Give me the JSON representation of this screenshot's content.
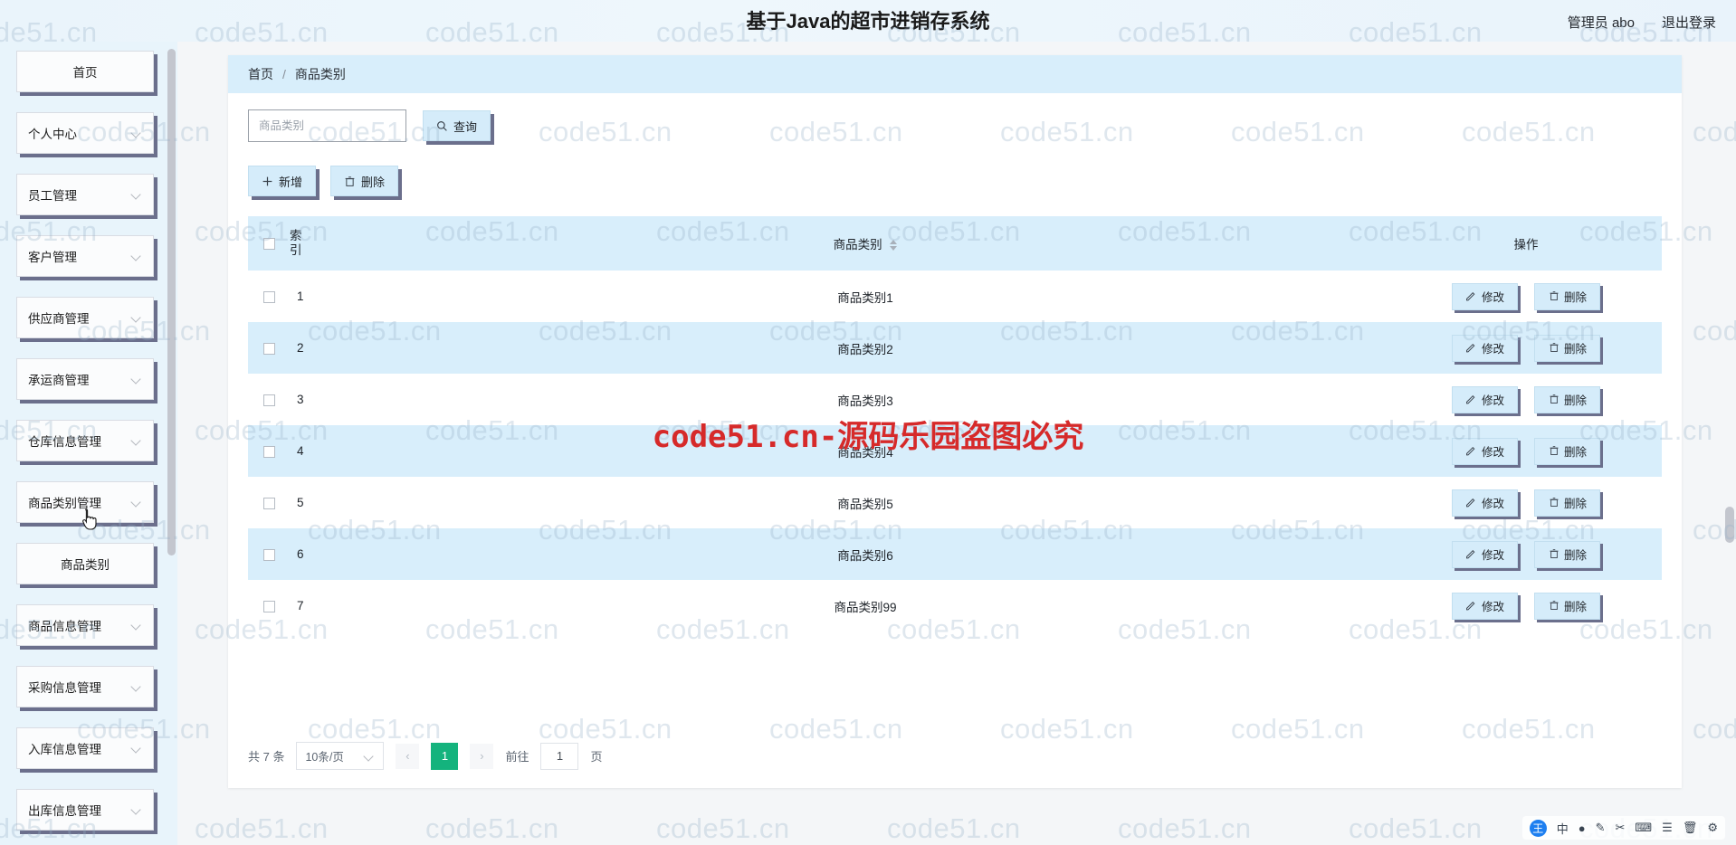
{
  "header": {
    "title": "基于Java的超市进销存系统",
    "admin_label": "管理员 abo",
    "logout_label": "退出登录"
  },
  "sidebar": {
    "items": [
      {
        "label": "首页",
        "has_chevron": false,
        "centered": true
      },
      {
        "label": "个人中心",
        "has_chevron": true,
        "centered": false
      },
      {
        "label": "员工管理",
        "has_chevron": true,
        "centered": false
      },
      {
        "label": "客户管理",
        "has_chevron": true,
        "centered": false
      },
      {
        "label": "供应商管理",
        "has_chevron": true,
        "centered": false
      },
      {
        "label": "承运商管理",
        "has_chevron": true,
        "centered": false
      },
      {
        "label": "仓库信息管理",
        "has_chevron": true,
        "centered": false
      },
      {
        "label": "商品类别管理",
        "has_chevron": true,
        "centered": false
      },
      {
        "label": "商品类别",
        "has_chevron": false,
        "centered": true
      },
      {
        "label": "商品信息管理",
        "has_chevron": true,
        "centered": false
      },
      {
        "label": "采购信息管理",
        "has_chevron": true,
        "centered": false
      },
      {
        "label": "入库信息管理",
        "has_chevron": true,
        "centered": false
      },
      {
        "label": "出库信息管理",
        "has_chevron": true,
        "centered": false
      }
    ]
  },
  "breadcrumb": {
    "home": "首页",
    "separator": "/",
    "current": "商品类别"
  },
  "search": {
    "placeholder": "商品类别",
    "value": "",
    "query_label": "查询",
    "query_icon": "search-icon"
  },
  "actions": {
    "add_label": "新增",
    "add_icon": "plus-icon",
    "delete_label": "删除",
    "delete_icon": "trash-icon"
  },
  "table": {
    "columns": {
      "index": "索引",
      "name": "商品类别",
      "ops": "操作"
    },
    "row_edit_label": "修改",
    "row_edit_icon": "pencil-icon",
    "row_delete_label": "删除",
    "row_delete_icon": "trash-icon",
    "rows": [
      {
        "index": "1",
        "name": "商品类别1"
      },
      {
        "index": "2",
        "name": "商品类别2"
      },
      {
        "index": "3",
        "name": "商品类别3"
      },
      {
        "index": "4",
        "name": "商品类别4"
      },
      {
        "index": "5",
        "name": "商品类别5"
      },
      {
        "index": "6",
        "name": "商品类别6"
      },
      {
        "index": "7",
        "name": "商品类别99"
      }
    ]
  },
  "pagination": {
    "total_label": "共 7 条",
    "page_size_label": "10条/页",
    "prev_icon": "chevron-left-icon",
    "next_icon": "chevron-right-icon",
    "current_page": "1",
    "goto_label": "前往",
    "goto_value": "1",
    "page_unit": "页"
  },
  "watermark": {
    "tile_text": "code51.cn",
    "center_text": "code51.cn-源码乐园盗图必究",
    "center_color": "#d62a2a"
  },
  "ime": {
    "logo_text": "王",
    "mode_label": "中",
    "items": [
      "中",
      "●",
      "✎",
      "✂",
      "⌨",
      "☰",
      "🗑",
      "⚙"
    ]
  },
  "colors": {
    "header_bg": "#eaf4fb",
    "accent_blue": "#d8eefb",
    "button_shadow": "#6b6f8c",
    "page_active": "#14b37d"
  }
}
